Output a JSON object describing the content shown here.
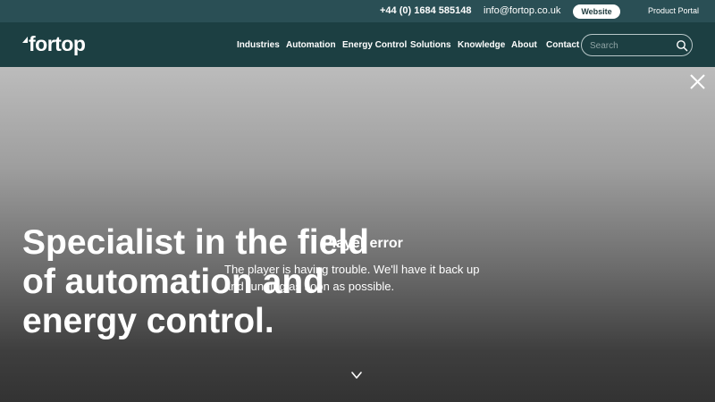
{
  "topbar": {
    "phone": "+44 (0) 1684 585148",
    "email": "info@fortop.co.uk",
    "website_label": "Website",
    "portal_label": "Product Portal"
  },
  "brand": {
    "name": "fortop"
  },
  "nav": {
    "items": [
      "Industries",
      "Automation",
      "Energy Control",
      "Solutions",
      "Knowledge",
      "About",
      "Contact"
    ],
    "search_placeholder": "Search"
  },
  "hero": {
    "headline": [
      "Specialist in the field",
      "of automation and",
      "energy control."
    ]
  },
  "player_error": {
    "title": "Player error",
    "message": "The player is having trouble. We'll have it back up and running as soon as possible."
  },
  "icons": {
    "search": "search-icon",
    "close": "close-icon",
    "scroll_down": "chevron-down-icon"
  },
  "colors": {
    "topbar_bg": "#2a4f55",
    "navbar_bg": "#1c3f42",
    "text": "#ffffff"
  }
}
